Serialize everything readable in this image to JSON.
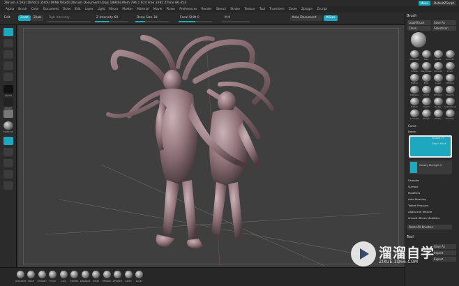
{
  "titlebar": {
    "title": "ZBrush 3.5R3  [DEVICE ZHOU WIN8 RIGID]   ZBrush Document   [Objs 18946]  Mem 794.1 674  Free 3381  ZTime 86.453",
    "menu_btn": "Menu",
    "script_btn": "DefaultZScript"
  },
  "menubar": {
    "items": [
      "Alpha",
      "Brush",
      "Color",
      "Document",
      "Draw",
      "Edit",
      "Layer",
      "Light",
      "Macro",
      "Marker",
      "Material",
      "Movie",
      "Picker",
      "Preferences",
      "Render",
      "Stencil",
      "Stroke",
      "Texture",
      "Tool",
      "Transform",
      "Zoom",
      "Zplugin",
      "Zscript"
    ]
  },
  "toptool": {
    "edit": "Edit",
    "zadd": "Zadd",
    "zsub": "Zsub",
    "rgb_intensity": "Rgb  Intensity",
    "z_intensity": "Z Intensity 60",
    "draw_size": "Draw Size 38",
    "focal_shift": "Focal Shift 0",
    "m": "M 0",
    "new_document": "New Document",
    "wsize": "WSize"
  },
  "leftshelf": {
    "labels": [
      "Alpha",
      "Stroke",
      "Material",
      "Xpose",
      "Persp",
      "Floor",
      "LSym",
      "Frame",
      "Move",
      "Scale",
      "Rotate",
      "Polyf"
    ]
  },
  "bottom": {
    "brushes": [
      "Standard",
      "Move",
      "Smooth",
      "Pinch",
      "Clay",
      "Flatten",
      "Displace",
      "Inflat",
      "MPolish",
      "ZProject",
      "Slash",
      "Layer"
    ]
  },
  "rpanel": {
    "brush_title": "Brush",
    "load_brush": "Load Brush",
    "save_as": "Save As",
    "clone": "Clone",
    "select_icon": "SelectIcon",
    "tiles": [
      "Standard",
      "Clay",
      "Move",
      "Smooth",
      "Inflate",
      "ClayTubes",
      "Smooth",
      "Pinch",
      "Flatten",
      "Blob",
      "Layer",
      "MPolish",
      "Displace",
      "Pinch",
      "ZProject",
      "Magnify",
      "Flatten",
      "Slash3",
      "Nudge",
      "SnakeHook",
      "Crumple",
      "Morph",
      "Elastic",
      "TrimDyn"
    ],
    "curve": "Curve",
    "depth": "Depth",
    "embed": "Embed 57",
    "depth_mask": "Depth Mask",
    "gravity": "Gravity Strength 0",
    "sections": [
      "Samples",
      "Surface",
      "Modifiers",
      "Auto Masking",
      "Tablet Pressure",
      "Alpha and Texture",
      "Smooth Brush Modifiers"
    ],
    "reset": "Reset All Brushes",
    "tool_title": "Tool",
    "save_as2": "Save As",
    "import": "Import",
    "export": "Export"
  },
  "watermark": {
    "name": "溜溜自学",
    "url": "ZIXUE.3D66.COM"
  },
  "colors": {
    "accent": "#1ea8c0",
    "canvas": "#3f3f3f",
    "panel": "#2a2a2a"
  }
}
